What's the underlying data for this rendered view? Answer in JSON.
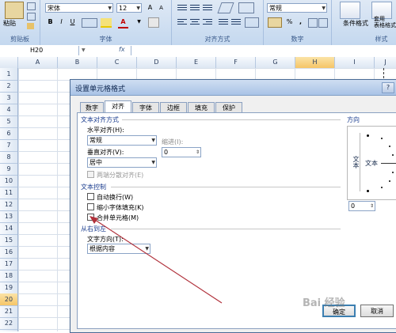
{
  "ribbon": {
    "paste_label": "粘贴",
    "clipboard_label": "剪贴板",
    "font_name": "宋体",
    "font_size": "12",
    "font_group_label": "字体",
    "bold": "B",
    "italic": "I",
    "underline": "U",
    "font_color_glyph": "A",
    "align_group_label": "对齐方式",
    "number_format": "常规",
    "number_group_label": "数字",
    "percent_glyph": "%",
    "comma_glyph": ",",
    "cond_format_label": "条件格式",
    "table_format_label": "套用\n表格格式",
    "style_group_label": "样式"
  },
  "formula_bar": {
    "name_box": "H20",
    "fx": "fx",
    "value": ""
  },
  "grid": {
    "columns": [
      "A",
      "B",
      "C",
      "D",
      "E",
      "F",
      "G",
      "H",
      "I",
      "J"
    ],
    "selected_column": "H",
    "rows": [
      "1",
      "2",
      "3",
      "4",
      "5",
      "6",
      "7",
      "8",
      "9",
      "10",
      "11",
      "12",
      "13",
      "14",
      "15",
      "16",
      "17",
      "18",
      "19",
      "20",
      "21",
      "22"
    ],
    "selected_row": "20"
  },
  "dialog": {
    "title": "设置单元格格式",
    "tabs": [
      "数字",
      "对齐",
      "字体",
      "边框",
      "填充",
      "保护"
    ],
    "active_tab": "对齐",
    "text_align_section": "文本对齐方式",
    "horizontal_label": "水平对齐(H):",
    "horizontal_value": "常规",
    "indent_label": "缩进(I):",
    "indent_value": "0",
    "vertical_label": "垂直对齐(V):",
    "vertical_value": "居中",
    "distributed_label": "两端分散对齐(E)",
    "text_control_section": "文本控制",
    "wrap_label": "自动换行(W)",
    "shrink_label": "缩小字体填充(K)",
    "merge_label": "合并单元格(M)",
    "rtl_section": "从右到左",
    "direction_label": "文字方向(T):",
    "direction_value": "根据内容",
    "orientation_section": "方向",
    "vertical_text": "文本",
    "horizontal_text": "文本",
    "degree_value": "0",
    "ok_label": "确定",
    "cancel_label": "取消"
  },
  "watermark": "Bai 经验"
}
